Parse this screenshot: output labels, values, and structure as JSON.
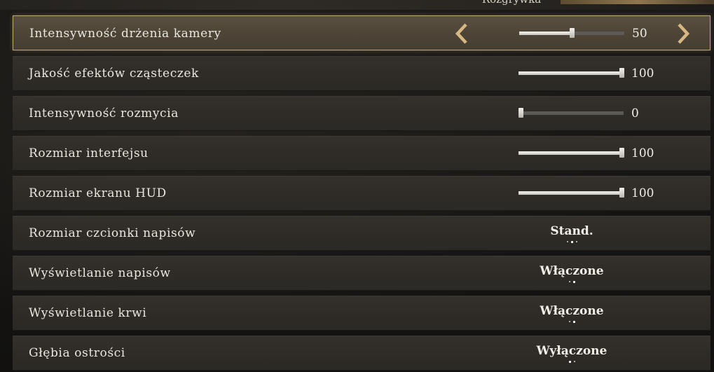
{
  "header": {
    "tab_label": "Rozgrywka"
  },
  "colors": {
    "accent_gold": "#c4a777",
    "row_bg": "#2f2c28",
    "selected_bg": "#4e4537",
    "text": "#ebe7df"
  },
  "settings": [
    {
      "label": "Intensywność drżenia kamery",
      "type": "slider",
      "value": "50",
      "level": 0.5,
      "selected": true
    },
    {
      "label": "Jakość efektów cząsteczek",
      "type": "slider",
      "value": "100",
      "level": 1.0
    },
    {
      "label": "Intensywność rozmycia",
      "type": "slider",
      "value": "0",
      "level": 0.0
    },
    {
      "label": "Rozmiar interfejsu",
      "type": "slider",
      "value": "100",
      "level": 1.0
    },
    {
      "label": "Rozmiar ekranu HUD",
      "type": "slider",
      "value": "100",
      "level": 1.0
    },
    {
      "label": "Rozmiar czcionki napisów",
      "type": "choice",
      "value": "Stand.",
      "options_count": 3,
      "selected_index": 1
    },
    {
      "label": "Wyświetlanie napisów",
      "type": "choice",
      "value": "Włączone",
      "options_count": 2,
      "selected_index": 1
    },
    {
      "label": "Wyświetlanie krwi",
      "type": "choice",
      "value": "Włączone",
      "options_count": 2,
      "selected_index": 1
    },
    {
      "label": "Głębia ostrości",
      "type": "choice",
      "value": "Wyłączone",
      "options_count": 2,
      "selected_index": 0
    }
  ],
  "icons": {
    "left_arrow": "chevron-left-icon",
    "right_arrow": "chevron-right-icon"
  }
}
